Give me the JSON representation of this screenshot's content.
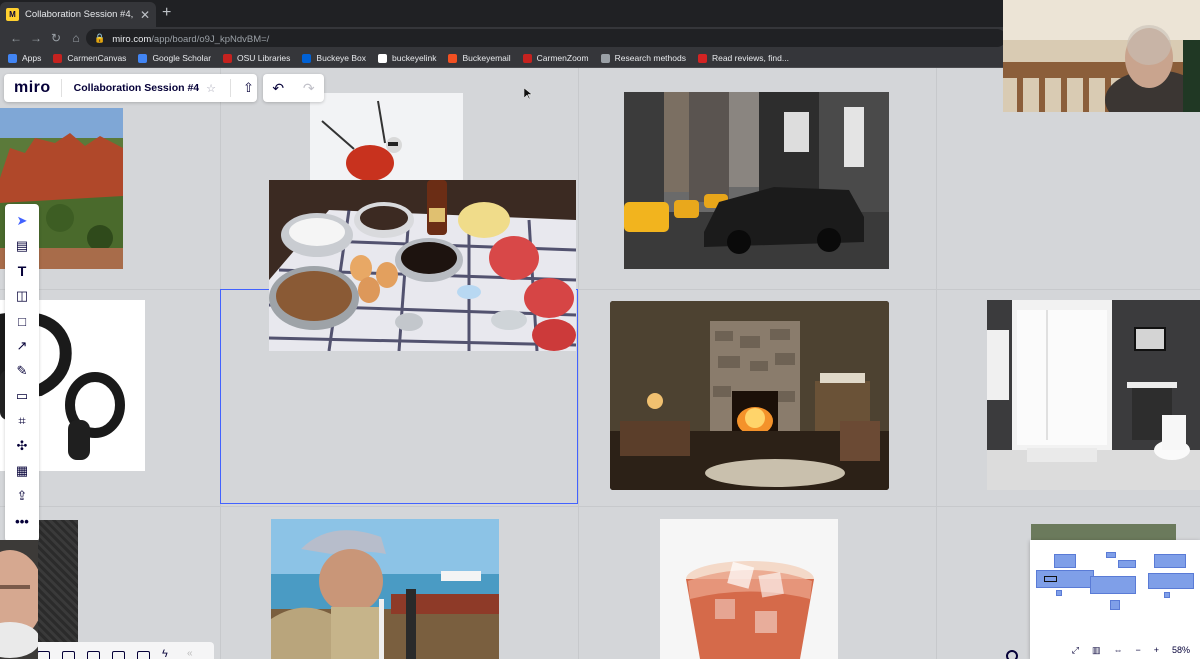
{
  "browser": {
    "tab_title": "Collaboration Session #4, Onli",
    "favicon_letter": "M",
    "url_host": "miro.com",
    "url_path": "/app/board/o9J_kpNdvBM=/",
    "bookmarks": [
      {
        "label": "Apps",
        "color": "#4285f4"
      },
      {
        "label": "CarmenCanvas",
        "color": "#c5221f"
      },
      {
        "label": "Google Scholar",
        "color": "#4285f4"
      },
      {
        "label": "OSU Libraries",
        "color": "#c5221f"
      },
      {
        "label": "Buckeye Box",
        "color": "#0061d5"
      },
      {
        "label": "buckeyelink",
        "color": "#ffffff"
      },
      {
        "label": "Buckeyemail",
        "color": "#f25022"
      },
      {
        "label": "CarmenZoom",
        "color": "#c5221f"
      },
      {
        "label": "Research methods",
        "color": "#9aa0a6"
      },
      {
        "label": "Read reviews, find...",
        "color": "#d32323"
      }
    ]
  },
  "miro": {
    "logo": "miro",
    "board_name": "Collaboration Session #4",
    "zoom_level": "58%"
  },
  "toolbar": {
    "tools": [
      "select",
      "templates",
      "text",
      "sticky-note",
      "shape",
      "connection-line",
      "pen",
      "comment",
      "frame",
      "mind-map",
      "table",
      "upload",
      "more"
    ]
  },
  "images": [
    {
      "name": "desert-canyon-photo",
      "subject": "canyon"
    },
    {
      "name": "skier-photo",
      "subject": "skier"
    },
    {
      "name": "baking-ingredients-photo",
      "subject": "baking"
    },
    {
      "name": "city-street-photo",
      "subject": "city"
    },
    {
      "name": "vr-controllers-photo",
      "subject": "controllers"
    },
    {
      "name": "fireplace-living-room-photo",
      "subject": "fireplace"
    },
    {
      "name": "bathroom-shower-photo",
      "subject": "bathroom"
    },
    {
      "name": "old-man-boat-photo",
      "subject": "old-man"
    },
    {
      "name": "iced-drink-photo",
      "subject": "drink"
    }
  ]
}
